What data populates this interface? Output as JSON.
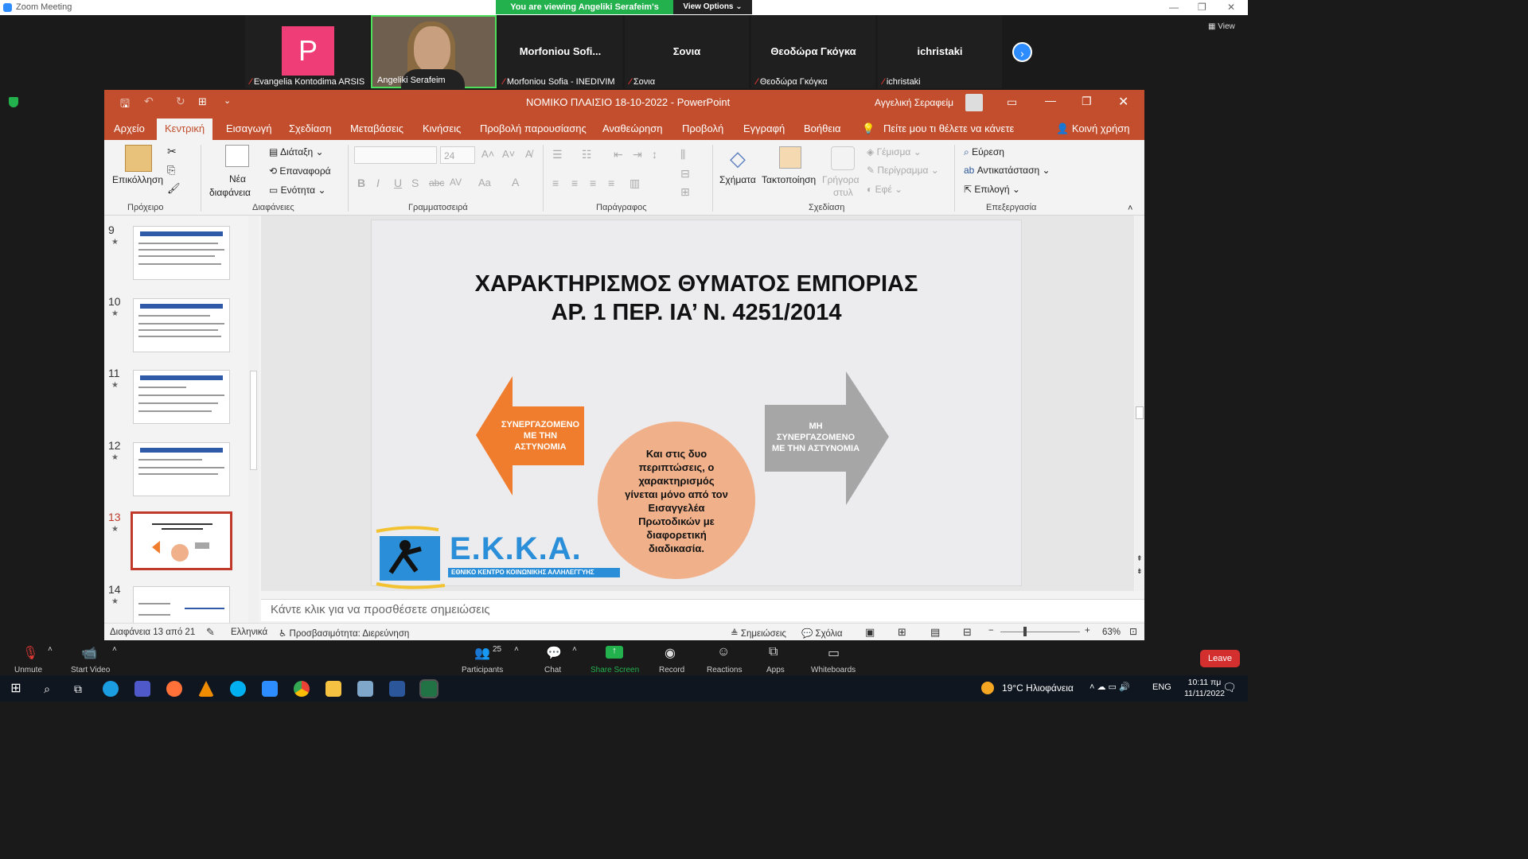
{
  "zoom": {
    "window_title": "Zoom Meeting",
    "viewing_banner": "You are viewing Angeliki Serafeim's screen",
    "view_options": "View Options",
    "view_label": "View",
    "participants": [
      {
        "display": "P",
        "caption": "Evangelia Kontodima ARSIS"
      },
      {
        "display": "",
        "caption": "Angeliki Serafeim"
      },
      {
        "display": "Morfoniou  Sofi...",
        "caption": "Morfoniou Sofia - INEDIVIM"
      },
      {
        "display": "Σονια",
        "caption": "Σονια"
      },
      {
        "display": "Θεοδώρα Γκόγκα",
        "caption": "Θεοδώρα Γκόγκα"
      },
      {
        "display": "ichristaki",
        "caption": "ichristaki"
      }
    ],
    "toolbar": {
      "unmute": "Unmute",
      "start_video": "Start Video",
      "participants": "Participants",
      "participants_count": "25",
      "chat": "Chat",
      "share_screen": "Share Screen",
      "record": "Record",
      "reactions": "Reactions",
      "apps": "Apps",
      "whiteboards": "Whiteboards",
      "leave": "Leave"
    }
  },
  "ppt": {
    "title": "ΝΟΜΙΚΟ ΠΛΑΙΣΙΟ 18-10-2022  -  PowerPoint",
    "user": "Αγγελική Σεραφείμ",
    "tabs": [
      "Αρχείο",
      "Κεντρική",
      "Εισαγωγή",
      "Σχεδίαση",
      "Μεταβάσεις",
      "Κινήσεις",
      "Προβολή παρουσίασης",
      "Αναθεώρηση",
      "Προβολή",
      "Εγγραφή",
      "Βοήθεια"
    ],
    "tell_me": "Πείτε μου τι θέλετε να κάνετε",
    "share": "Κοινή χρήση",
    "ribbon": {
      "paste": "Επικόλληση",
      "clipboard": "Πρόχειρο",
      "new_slide_1": "Νέα",
      "new_slide_2": "διαφάνεια",
      "layout": "Διάταξη",
      "reset": "Επαναφορά",
      "section": "Ενότητα",
      "slides": "Διαφάνειες",
      "font_size": "24",
      "font": "Γραμματοσειρά",
      "paragraph": "Παράγραφος",
      "shapes": "Σχήματα",
      "arrange": "Τακτοποίηση",
      "quick_styles_1": "Γρήγορα",
      "quick_styles_2": "στυλ",
      "fill": "Γέμισμα",
      "outline": "Περίγραμμα",
      "effects": "Εφέ",
      "drawing": "Σχεδίαση",
      "find": "Εύρεση",
      "replace": "Αντικατάσταση",
      "select": "Επιλογή",
      "editing": "Επεξεργασία"
    },
    "thumb_numbers": [
      "9",
      "10",
      "11",
      "12",
      "13",
      "14"
    ],
    "slide": {
      "title_line1": "ΧΑΡΑΚΤΗΡΙΣΜΟΣ ΘΥΜΑΤΟΣ ΕΜΠΟΡΙΑΣ",
      "title_line2": "ΑΡ. 1 ΠΕΡ. ΙΑ’ Ν. 4251/2014",
      "left_arrow": [
        "ΣΥΝΕΡΓΑΖΟΜΕΝΟ",
        "ΜΕ ΤΗΝ",
        "ΑΣΤΥΝΟΜΙΑ"
      ],
      "right_arrow": [
        "ΜΗ",
        "ΣΥΝΕΡΓΑΖΟΜΕΝΟ",
        "ΜΕ ΤΗΝ ΑΣΤΥΝΟΜΙΑ"
      ],
      "circle": [
        "Και στις δυο",
        "περιπτώσεις, ο",
        "χαρακτηρισμός",
        "γίνεται μόνο από τον",
        "Εισαγγελέα",
        "Πρωτοδικών με",
        "διαφορετική",
        "διαδικασία."
      ],
      "logo_text": "Ε.Κ.Κ.Α.",
      "logo_sub": "ΕΘΝΙΚΟ ΚΕΝΤΡΟ ΚΟΙΝΩΝΙΚΗΣ ΑΛΛΗΛΕΓΓΥΗΣ"
    },
    "notes_placeholder": "Κάντε κλικ για να προσθέσετε σημειώσεις",
    "status": {
      "slide": "Διαφάνεια 13 από 21",
      "lang": "Ελληνικά",
      "access": "Προσβασιμότητα: Διερεύνηση",
      "notes": "Σημειώσεις",
      "comments": "Σχόλια",
      "zoom": "63%"
    }
  },
  "taskbar": {
    "weather": "19°C  Ηλιοφάνεια",
    "lang": "ENG",
    "time": "10:11 πμ",
    "date": "11/11/2022"
  },
  "colors": {
    "ppt_accent": "#c24e2d",
    "zoom_green": "#23b14d",
    "arrow_orange": "#ef7d2d",
    "arrow_gray": "#a6a6a6",
    "circle": "#f0b08a"
  }
}
